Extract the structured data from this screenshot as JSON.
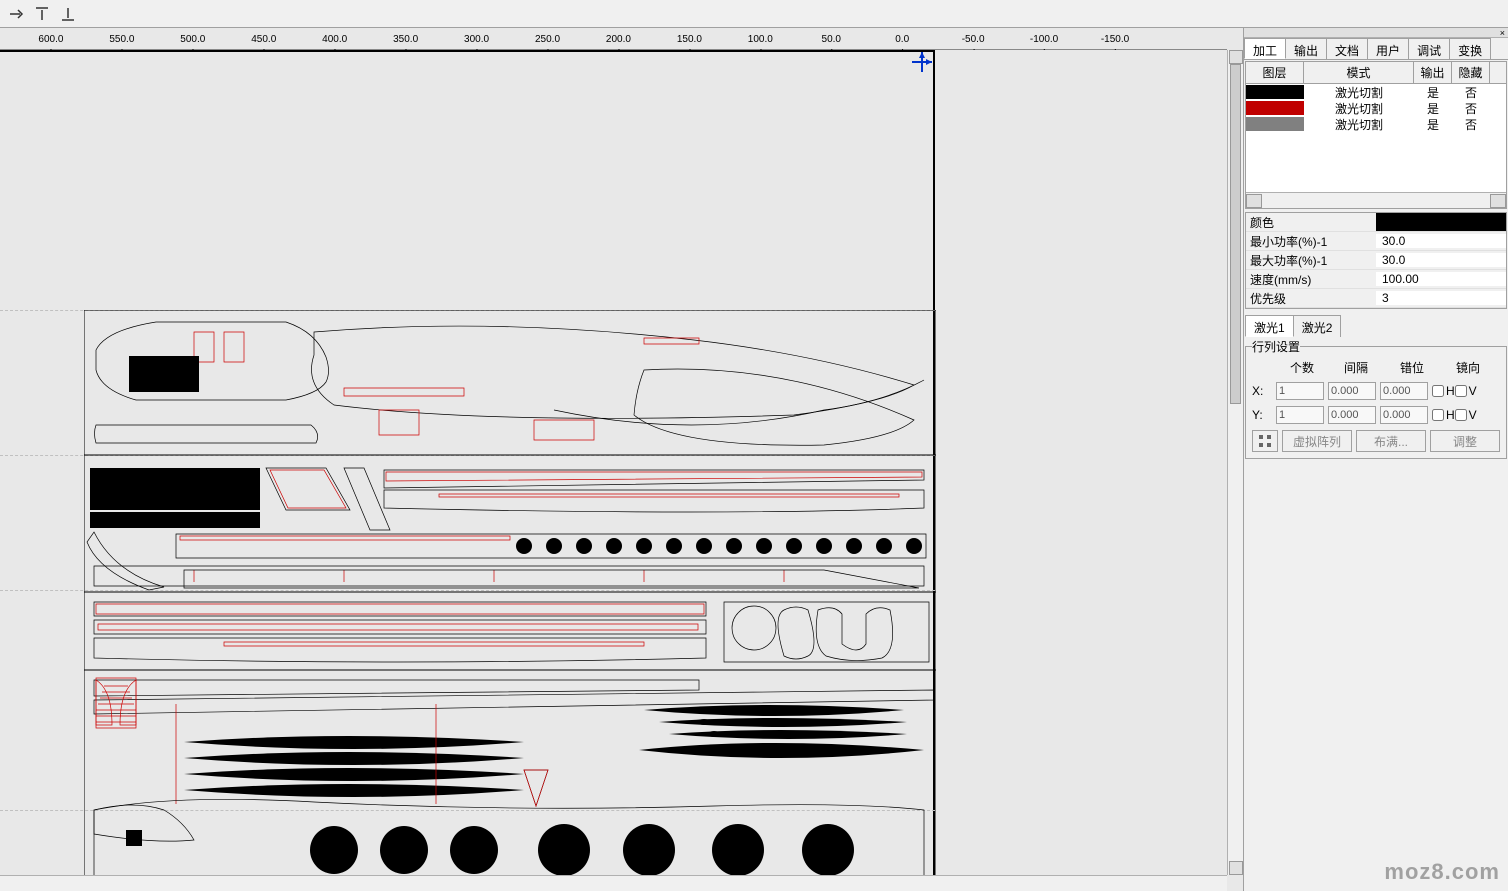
{
  "ruler": {
    "ticks": [
      "50.0",
      "600.0",
      "550.0",
      "500.0",
      "450.0",
      "400.0",
      "350.0",
      "300.0",
      "250.0",
      "200.0",
      "150.0",
      "100.0",
      "50.0",
      "0.0",
      "-50.0",
      "-100.0",
      "-150.0"
    ]
  },
  "panel": {
    "close": "×",
    "main_tabs": [
      "加工",
      "输出",
      "文档",
      "用户",
      "调试",
      "变换"
    ],
    "layers": {
      "head": {
        "layer": "图层",
        "mode": "模式",
        "output": "输出",
        "hidden": "隐藏"
      },
      "rows": [
        {
          "color": "#000000",
          "mode": "激光切割",
          "output": "是",
          "hidden": "否"
        },
        {
          "color": "#c00000",
          "mode": "激光切割",
          "output": "是",
          "hidden": "否"
        },
        {
          "color": "#808080",
          "mode": "激光切割",
          "output": "是",
          "hidden": "否"
        }
      ]
    },
    "props": {
      "color_label": "颜色",
      "color_value": "#000000",
      "min_power_label": "最小功率(%)-1",
      "min_power_value": "30.0",
      "max_power_label": "最大功率(%)-1",
      "max_power_value": "30.0",
      "speed_label": "速度(mm/s)",
      "speed_value": "100.00",
      "priority_label": "优先级",
      "priority_value": "3"
    },
    "sub_tabs": [
      "激光1",
      "激光2"
    ],
    "array": {
      "title": "行列设置",
      "head": {
        "count": "个数",
        "gap": "间隔",
        "offset": "错位",
        "mirror": "镜向"
      },
      "x_label": "X:",
      "y_label": "Y:",
      "x_count": "1",
      "x_gap": "0.000",
      "x_off": "0.000",
      "y_count": "1",
      "y_gap": "0.000",
      "y_off": "0.000",
      "h": "H",
      "v": "V",
      "btn_virtual": "虚拟阵列",
      "btn_fill": "布满...",
      "btn_adjust": "调整"
    }
  },
  "watermark": "moz8.com"
}
